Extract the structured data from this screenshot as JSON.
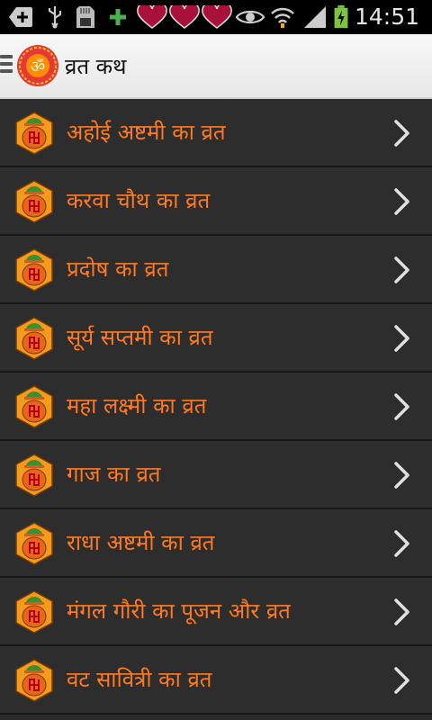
{
  "status_bar": {
    "time": "14:51",
    "icons": [
      "add-icon",
      "usb-icon",
      "sd-card-icon",
      "plus-icon",
      "heart-icon",
      "heart-icon",
      "heart-icon",
      "eye-icon",
      "wifi-icon",
      "signal-icon",
      "battery-charging-icon"
    ]
  },
  "action_bar": {
    "title": "व्रत कथ",
    "logo_glyph": "ॐ"
  },
  "list": {
    "items": [
      {
        "label": "अहोई अष्टमी का व्रत"
      },
      {
        "label": "करवा चौथ का व्रत"
      },
      {
        "label": "प्रदोष का व्रत"
      },
      {
        "label": "सूर्य सप्तमी का व्रत"
      },
      {
        "label": "महा लक्ष्मी का व्रत"
      },
      {
        "label": "गाज का व्रत"
      },
      {
        "label": "राधा अष्टमी का व्रत"
      },
      {
        "label": "मंगल गौरी का पूजन और व्रत"
      },
      {
        "label": "वट सावित्री का व्रत"
      }
    ]
  },
  "colors": {
    "item_text": "#ff7a21",
    "list_bg": "#2d2d2d",
    "chevron": "#e0e0e0"
  }
}
